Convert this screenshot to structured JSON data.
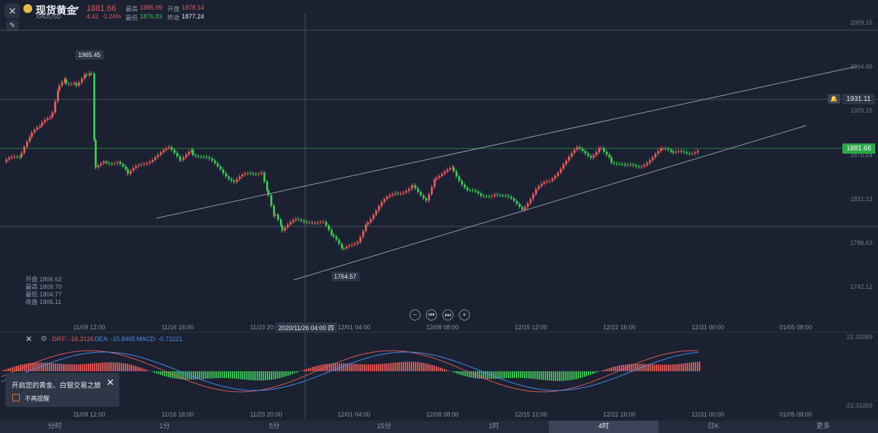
{
  "header": {
    "title": "现货黄金",
    "symbol": "XAUUSD",
    "price": "1881.66",
    "change": "4.42",
    "change_pct": "0.24%",
    "high_label": "最高",
    "high": "1885.99",
    "low_label": "最低",
    "low": "1876.83",
    "open_label": "开盘",
    "open": "1878.14",
    "prev_close_label": "昨收",
    "prev_close": "1877.24"
  },
  "chart": {
    "y_ticks": [
      "2009.16",
      "1964.66",
      "1920.15",
      "1876.64",
      "1831.13",
      "1786.63",
      "1742.12"
    ],
    "price_tag": "1881.66",
    "alert_tag": "1931.11",
    "high_marker": "1965.45",
    "low_marker": "1764.57",
    "crosshair_time": "2020/11/26 04:00 四",
    "ohlc": {
      "open": "开盘 1806.62",
      "high": "最高 1809.70",
      "low": "最低 1804.77",
      "close": "收盘 1806.11"
    },
    "x_ticks": [
      "11/09 12:00",
      "11/16 16:00",
      "11/23 20:00",
      "12/01 04:00",
      "12/08 08:00",
      "12/15 12:00",
      "12/22 16:00",
      "12/31 00:00",
      "01/05 08:00"
    ],
    "colors": {
      "up": "#e05a5a",
      "down": "#3fc256",
      "bg": "#1b2131",
      "accent": "#3fc256"
    }
  },
  "macd": {
    "diff": "DIFF: -16.2126",
    "dea": "DEA: -15.8465",
    "macd": "MACD: -0.73221",
    "y_top": "22.33269",
    "y_bottom": "-22.33269",
    "x_ticks": [
      "11/09 12:00",
      "11/16 16:00",
      "11/23 20:00",
      "12/01 04:00",
      "12/08 08:00",
      "12/15 12:00",
      "12/22 16:00",
      "12/31 00:00",
      "01/05 08:00"
    ]
  },
  "popup": {
    "message": "开启您的黄金、白银交易之旅",
    "checkbox_label": "不再提醒"
  },
  "tabs": [
    "分时",
    "1分",
    "5分",
    "15分",
    "1时",
    "4时",
    "日K",
    "更多"
  ],
  "active_tab": "4时"
}
